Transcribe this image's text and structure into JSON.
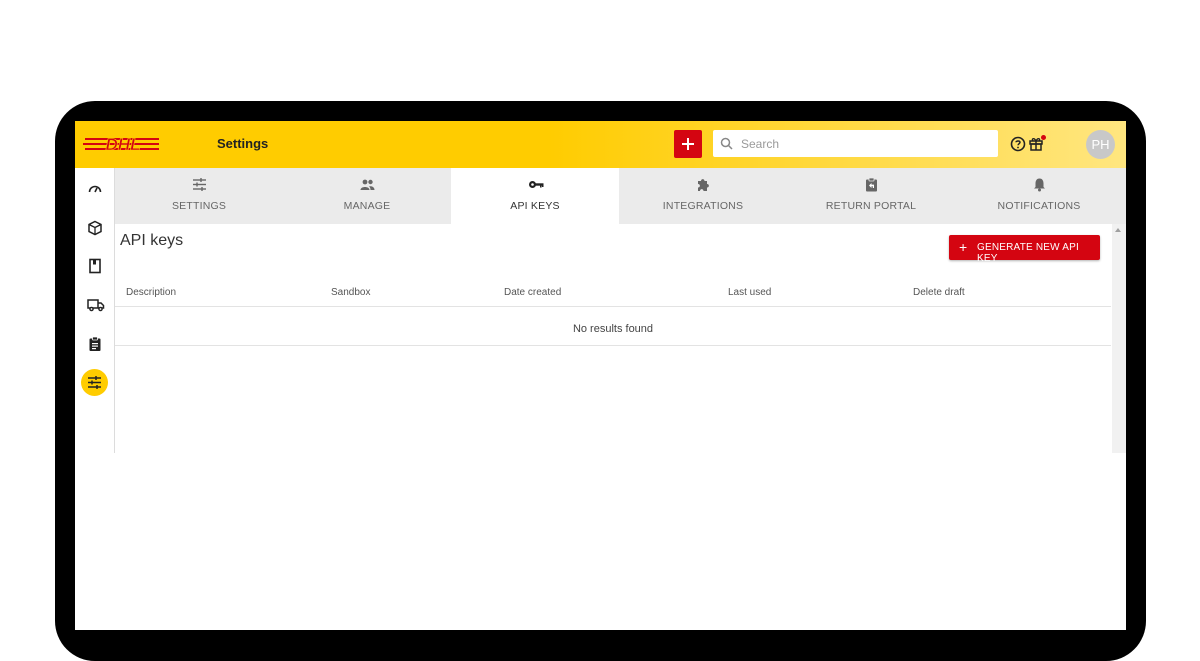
{
  "header": {
    "brand": "DHL",
    "title": "Settings",
    "add_label": "+",
    "search_placeholder": "Search",
    "avatar_initials": "PH",
    "colors": {
      "brand_yellow": "#ffcc00",
      "brand_red": "#d40511"
    }
  },
  "sidebar": {
    "items": [
      {
        "icon": "dashboard-icon"
      },
      {
        "icon": "package-icon"
      },
      {
        "icon": "book-icon"
      },
      {
        "icon": "truck-icon"
      },
      {
        "icon": "clipboard-icon"
      },
      {
        "icon": "settings-sliders-icon",
        "active": true
      }
    ]
  },
  "tabs": [
    {
      "label": "SETTINGS",
      "icon": "sliders-icon"
    },
    {
      "label": "MANAGE",
      "icon": "people-icon"
    },
    {
      "label": "API KEYS",
      "icon": "key-icon",
      "active": true
    },
    {
      "label": "INTEGRATIONS",
      "icon": "puzzle-icon"
    },
    {
      "label": "RETURN PORTAL",
      "icon": "return-icon"
    },
    {
      "label": "NOTIFICATIONS",
      "icon": "bell-icon"
    }
  ],
  "main": {
    "title": "API keys",
    "generate_button": "GENERATE NEW API KEY",
    "columns": [
      "Description",
      "Sandbox",
      "Date created",
      "Last used",
      "Delete draft"
    ],
    "empty_message": "No results found"
  }
}
